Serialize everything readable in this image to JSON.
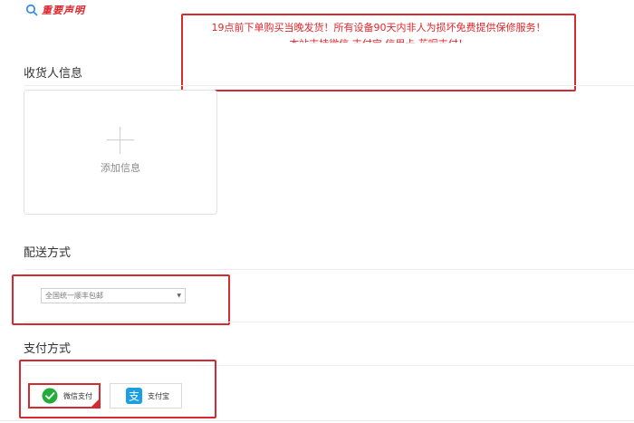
{
  "notice": {
    "title": "重要声明",
    "line1": "19点前下单购买当晚发货！所有设备90天内非人为损坏免费提供保修服务！",
    "line2": "本站支持微信 支付宝 信用卡 花呗支付！"
  },
  "receiver": {
    "section_title": "收货人信息",
    "add_label": "添加信息"
  },
  "shipping": {
    "section_title": "配送方式",
    "selected_option": "全国统一顺丰包邮"
  },
  "payment": {
    "section_title": "支付方式",
    "options": [
      {
        "label": "微信支付",
        "icon": "wechat-pay-icon",
        "selected": true
      },
      {
        "label": "支付宝",
        "icon": "alipay-icon",
        "selected": false
      }
    ]
  },
  "colors": {
    "accent_red": "#d62a32",
    "wechat_green": "#22ac38",
    "alipay_blue": "#1a9fe2"
  }
}
